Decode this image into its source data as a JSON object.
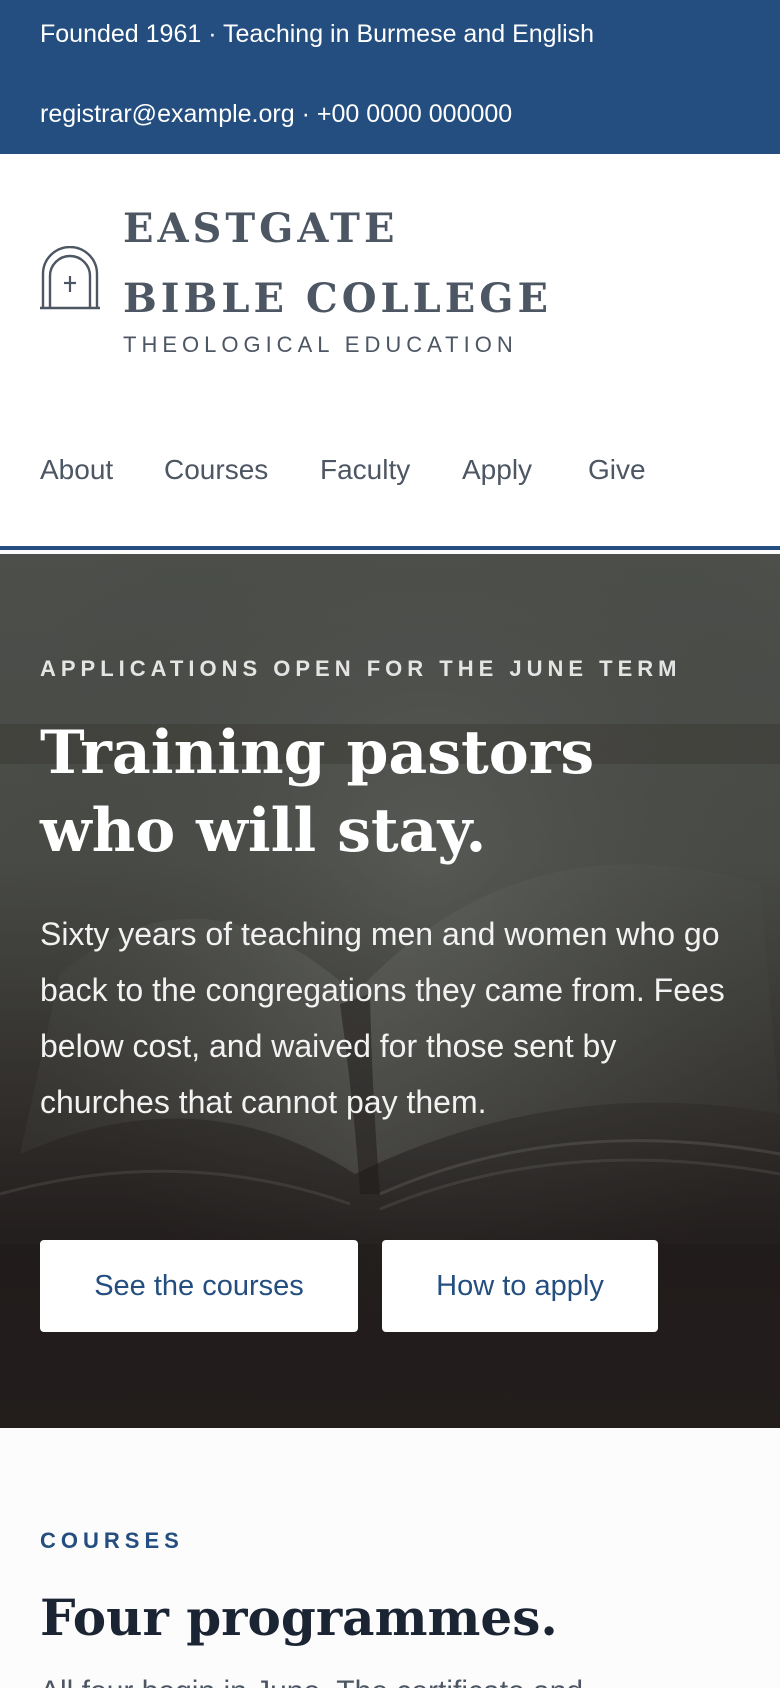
{
  "topbar": {
    "line1": "Founded 1961 · Teaching in Burmese and English",
    "line2": "registrar@example.org · +00 0000 000000"
  },
  "header": {
    "logo_icon": "arched-doorway-cross-icon",
    "brand_name": "EASTGATE BIBLE COLLEGE",
    "brand_sub": "THEOLOGICAL EDUCATION",
    "nav": [
      {
        "label": "About"
      },
      {
        "label": "Courses"
      },
      {
        "label": "Faculty"
      },
      {
        "label": "Apply"
      },
      {
        "label": "Give"
      }
    ],
    "accent": "#234e7f"
  },
  "hero": {
    "kicker": "APPLICATIONS OPEN FOR THE JUNE TERM",
    "headline": "Training pastors who will stay.",
    "lead": "Sixty years of teaching men and women who go back to the congregations they came from. Fees below cost, and waived for those sent by churches that cannot pay them.",
    "primary_button": "See the courses",
    "secondary_button": "How to apply",
    "background_image": "open-bible-photo"
  },
  "courses": {
    "kicker": "COURSES",
    "title": "Four programmes.",
    "intro": "All four begin in June. The certificate and"
  }
}
